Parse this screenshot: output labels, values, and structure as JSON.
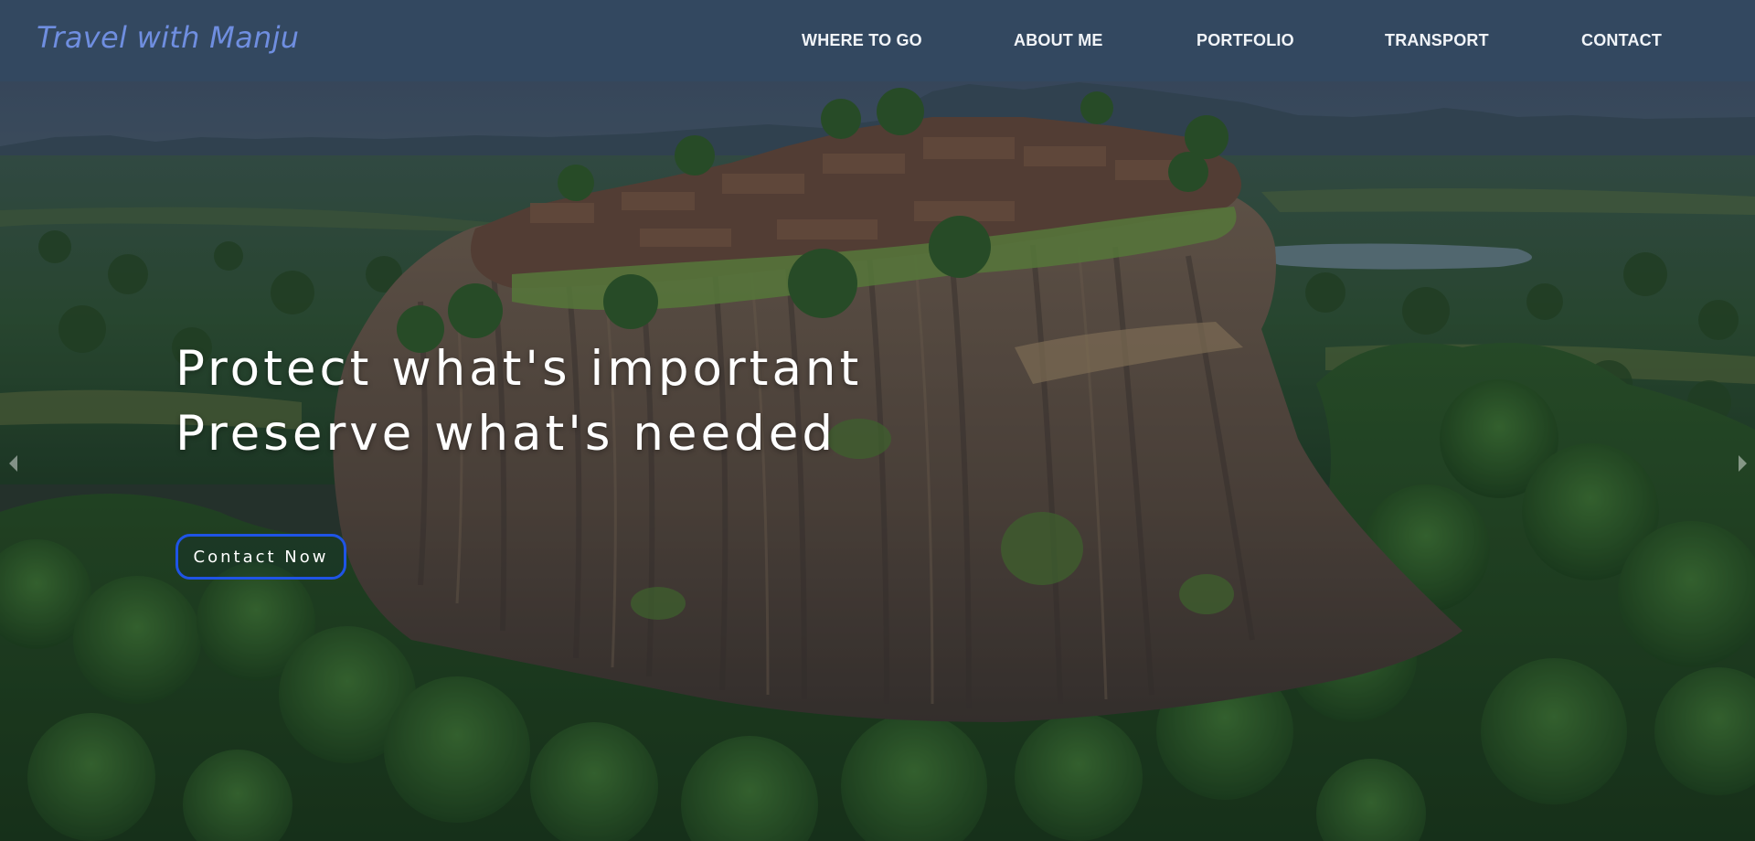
{
  "navbar": {
    "brand": "Travel with Manju",
    "links": [
      {
        "label": "WHERE TO GO"
      },
      {
        "label": "ABOUT ME"
      },
      {
        "label": "PORTFOLIO"
      },
      {
        "label": "TRANSPORT"
      },
      {
        "label": "CONTACT"
      }
    ]
  },
  "hero": {
    "headline_line1": "Protect what's important",
    "headline_line2": "Preserve what's needed",
    "cta_label": "Contact Now",
    "background_icon": "sigiriya-rock-photo",
    "carousel_prev_icon": "chevron-left-icon",
    "carousel_next_icon": "chevron-right-icon"
  },
  "colors": {
    "nav_bg": "#344860",
    "brand": "#6f8ee0",
    "nav_text": "#f1f4f8",
    "headline": "#ffffff",
    "cta_border": "#1f54e6"
  }
}
